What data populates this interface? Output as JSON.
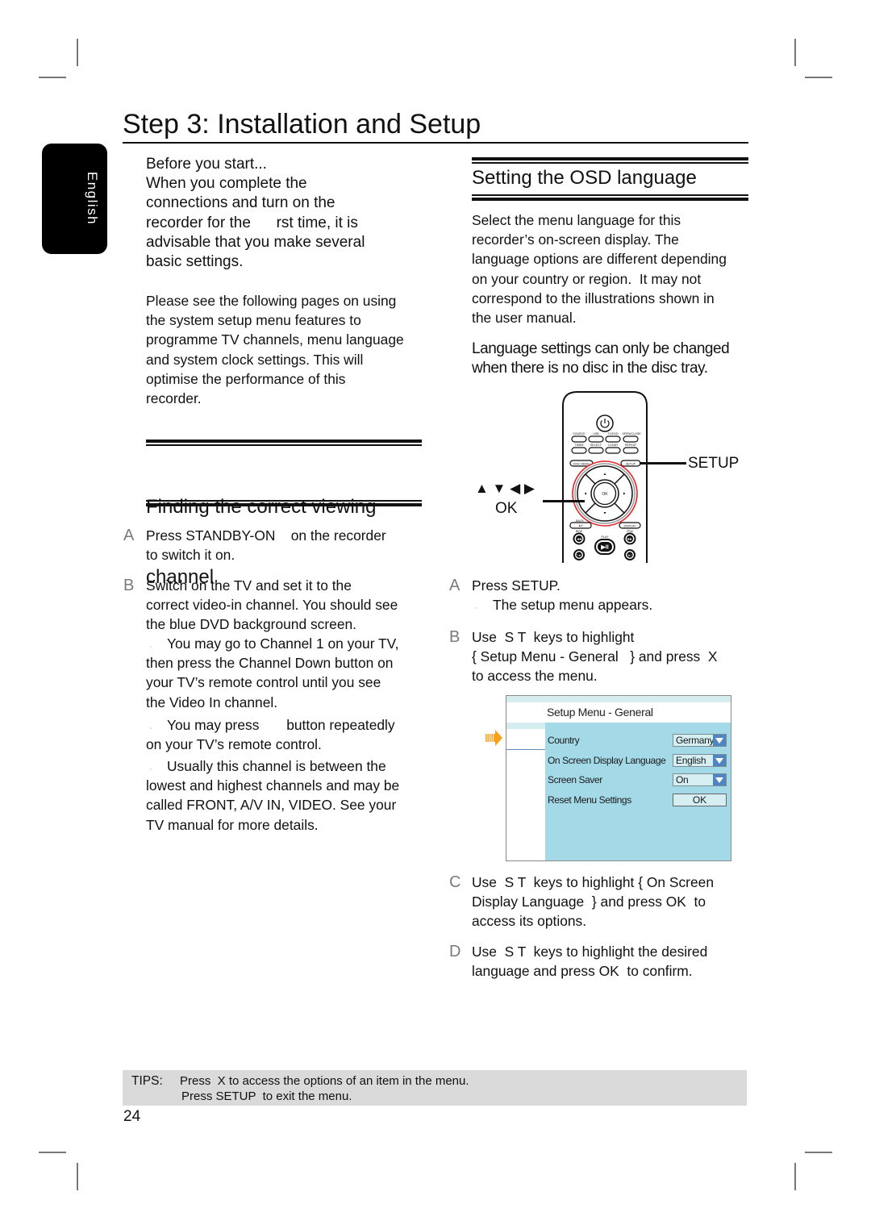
{
  "page": {
    "title": "Step 3: Installation and Setup",
    "language_tab": "English",
    "page_number": "24"
  },
  "before_you_start": {
    "lines": [
      "Before you start...",
      "When you complete the",
      "connections and turn on the",
      "recorder for the      rst time, it is",
      "advisable that you make several",
      "basic settings."
    ]
  },
  "intro_paragraph": {
    "lines": [
      "Please see the following pages on using",
      "the system setup menu features to",
      "programme TV channels, menu language",
      "and system clock settings. This will",
      "optimise the performance of this",
      "recorder."
    ]
  },
  "finding_channel": {
    "heading_lines": [
      "Finding the correct viewing",
      "channel"
    ],
    "steps": [
      {
        "letter": "A",
        "lines": [
          "Press STANDBY-ON    on the recorder",
          "to switch it on."
        ]
      },
      {
        "letter": "B",
        "lines": [
          "Switch on the TV and set it to the",
          "correct video-in channel. You should see",
          "the blue DVD background screen."
        ],
        "notes": [
          {
            "bullet": "‚",
            "lines": [
              "You may go to Channel 1 on your TV,",
              "then press the Channel Down button on",
              "your TV’s remote control until you see",
              "the Video In channel."
            ]
          },
          {
            "bullet": "‚",
            "lines": [
              "You may press       button repeatedly",
              "on your TV’s remote control."
            ]
          },
          {
            "bullet": "‚",
            "lines": [
              "Usually this channel is between the",
              "lowest and highest channels and may be",
              "called FRONT, A/V IN, VIDEO. See your",
              "TV manual for more details."
            ]
          }
        ]
      }
    ]
  },
  "osd_language": {
    "heading": "Setting the OSD language",
    "paragraph_lines": [
      "Select the menu language for this",
      "recorder’s on-screen display. The",
      "language options are different depending",
      "on your country or region.  It may not",
      "correspond to the illustrations shown in",
      "the user manual."
    ],
    "note_lines": [
      "Language settings can only be changed",
      "when there is no disc in the disc tray."
    ],
    "remote_callouts": {
      "setup": "SETUP",
      "arrows": "▲ ▼ ◀ ▶",
      "ok": "OK"
    },
    "remote_buttons": {
      "source": "SOURCE",
      "usb": "USB",
      "tv_dvd": "TV/DVD",
      "open_close": "OPEN/CLOSE",
      "timer": "TIMER",
      "select": "SELECT",
      "clear": "CLEAR",
      "repeat": "REPEAT",
      "disc_menu": "DISC MENU",
      "setup": "SETUP",
      "ok": "OK",
      "back": "BACK",
      "display": "DISPLAY",
      "rew": "REW",
      "ffw": "FFW",
      "play_pause": "PLAY",
      "back_glyph": "↩",
      "rew_glyph": "◀◀",
      "ffw_glyph": "▶▶",
      "play_glyph": "▶II",
      "prev_glyph": "I◀",
      "next_glyph": "▶I"
    },
    "steps": [
      {
        "letter": "A",
        "lines": [
          "Press SETUP."
        ],
        "note": {
          "bullet": "‚",
          "text": "The setup menu appears."
        }
      },
      {
        "letter": "B",
        "lines": [
          "Use  S T  keys to highlight",
          "{ Setup Menu - General   } and press  X",
          "to access the menu."
        ]
      },
      {
        "letter": "C",
        "lines": [
          "Use  S T  keys to highlight { On Screen",
          "Display Language  } and press OK  to",
          "access its options."
        ]
      },
      {
        "letter": "D",
        "lines": [
          "Use  S T  keys to highlight the desired",
          "language and press OK  to confirm."
        ]
      }
    ],
    "setup_menu": {
      "title": "Setup Menu - General",
      "rows": [
        {
          "label": "Country",
          "value": "Germany",
          "control": "dropdown"
        },
        {
          "label": "On Screen Display Language",
          "value": "English",
          "control": "dropdown"
        },
        {
          "label": "Screen Saver",
          "value": "On",
          "control": "dropdown"
        },
        {
          "label": "Reset Menu Settings",
          "value": "OK",
          "control": "button"
        }
      ]
    }
  },
  "tips": {
    "label": "TIPS:",
    "lines": [
      "Press  X to access the options of an item in the menu.",
      "Press SETUP  to exit the menu."
    ]
  },
  "colors": {
    "menu_background": "#a4d9e7",
    "menu_strip": "#d6edf0",
    "dropdown_arrow": "#4f86c1",
    "highlight_arrow": "#f7a21b",
    "remote_ring": "#e0262a",
    "tips_background": "#dadada",
    "step_letter": "#7a7a7a"
  }
}
